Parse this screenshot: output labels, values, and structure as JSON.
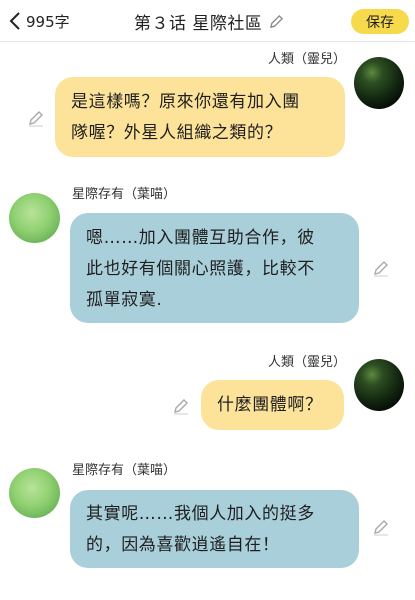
{
  "header": {
    "back_label": "995字",
    "title": "第３话 星際社區",
    "save_label": "保存"
  },
  "messages": [
    {
      "sender": "人類（靈兒）",
      "side": "right",
      "lines": [
        "是這樣嗎？原來你還有加入團",
        "隊喔？外星人組織之類的？"
      ]
    },
    {
      "sender": "星際存有（葉喵）",
      "side": "left",
      "lines": [
        "嗯……加入團體互助合作，彼",
        "此也好有個關心照護，比較不",
        "孤單寂寞."
      ]
    },
    {
      "sender": "人類（靈兒）",
      "side": "right",
      "lines": [
        "什麼團體啊？"
      ]
    },
    {
      "sender": "星際存有（葉喵）",
      "side": "left",
      "lines": [
        "其實呢……我個人加入的挺多",
        "的，因為喜歡逍遙自在！"
      ]
    }
  ],
  "colors": {
    "accent": "#f7d94c",
    "bubble_self": "#fde39a",
    "bubble_other": "#a9cfdb"
  },
  "icons": {
    "back": "chevron-left-icon",
    "title_edit": "pencil-icon",
    "bubble_edit": "pencil-icon"
  }
}
